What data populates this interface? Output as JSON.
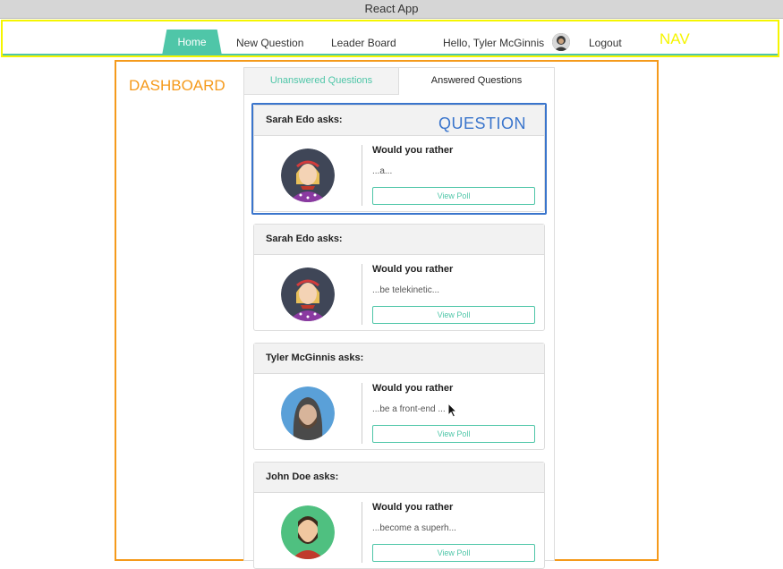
{
  "window": {
    "title": "React App"
  },
  "nav": {
    "items": [
      "Home",
      "New Question",
      "Leader Board"
    ],
    "greeting": "Hello, Tyler McGinnis",
    "logout": "Logout",
    "annotation_label": "NAV"
  },
  "dashboard": {
    "annotation_label": "DASHBOARD",
    "tabs": [
      "Unanswered Questions",
      "Answered Questions"
    ],
    "active_tab": "Unanswered Questions",
    "question_annotation_label": "QUESTION",
    "questions": [
      {
        "header": "Sarah Edo asks:",
        "heading": "Would you rather",
        "snippet": "...a...",
        "button": "View Poll"
      },
      {
        "header": "Sarah Edo asks:",
        "heading": "Would you rather",
        "snippet": "...be telekinetic...",
        "button": "View Poll"
      },
      {
        "header": "Tyler McGinnis asks:",
        "heading": "Would you rather",
        "snippet": "...be a front-end ...",
        "button": "View Poll"
      },
      {
        "header": "John Doe asks:",
        "heading": "Would you rather",
        "snippet": "...become a superh...",
        "button": "View Poll"
      }
    ]
  },
  "colors": {
    "accent": "#4fc6a8",
    "nav_annotation": "#f5f500",
    "dashboard_annotation": "#f59a1b",
    "question_annotation": "#3a75cc"
  }
}
